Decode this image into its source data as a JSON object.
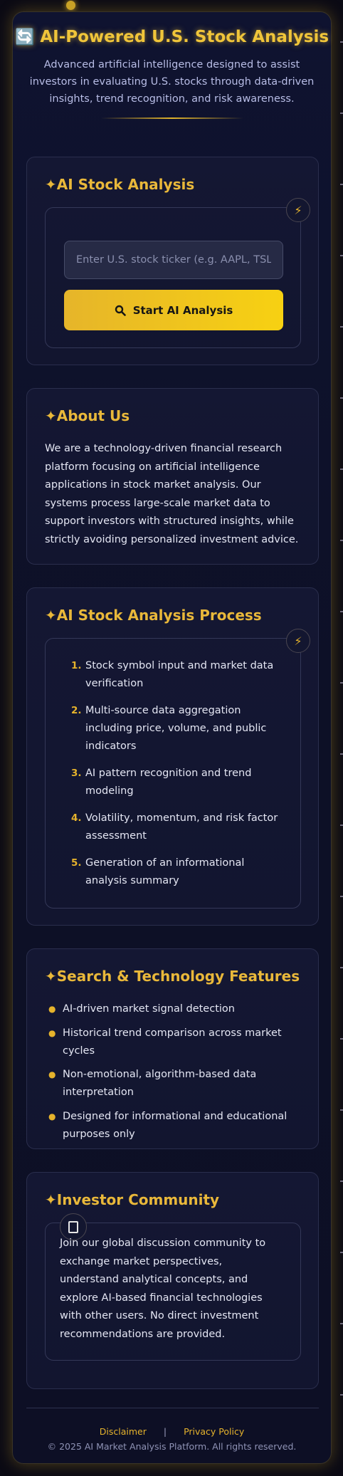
{
  "header": {
    "logo_icon": "🔄",
    "title": "AI-Powered U.S. Stock Analysis",
    "subtitle": "Advanced artificial intelligence designed to assist investors in evaluating U.S. stocks through data-driven insights, trend recognition, and risk awareness."
  },
  "analysis": {
    "title": "✦AI Stock Analysis",
    "badge_icon": "⚡",
    "input_placeholder": "Enter U.S. stock ticker (e.g. AAPL, TSLA, NVDA)",
    "button_label": "Start AI Analysis"
  },
  "about": {
    "title": "✦About Us",
    "text": "We are a technology-driven financial research platform focusing on artificial intelligence applications in stock market analysis. Our systems process large-scale market data to support investors with structured insights, while strictly avoiding personalized investment advice."
  },
  "process": {
    "title": "✦AI Stock Analysis Process",
    "badge_icon": "⚡",
    "steps": [
      {
        "num": "1.",
        "text": "Stock symbol input and market data verification"
      },
      {
        "num": "2.",
        "text": "Multi-source data aggregation including price, volume, and public indicators"
      },
      {
        "num": "3.",
        "text": "AI pattern recognition and trend modeling"
      },
      {
        "num": "4.",
        "text": "Volatility, momentum, and risk factor assessment"
      },
      {
        "num": "5.",
        "text": "Generation of an informational analysis summary"
      }
    ]
  },
  "features": {
    "title": "✦Search & Technology Features",
    "items": [
      "AI-driven market signal detection",
      "Historical trend comparison across market cycles",
      "Non-emotional, algorithm-based data interpretation",
      "Designed for informational and educational purposes only"
    ]
  },
  "community": {
    "title": "✦Investor Community",
    "text": "Join our global discussion community to exchange market perspectives, understand analytical concepts, and explore AI-based financial technologies with other users. No direct investment recommendations are provided."
  },
  "footer": {
    "disclaimer": "Disclaimer",
    "separator": "|",
    "privacy": "Privacy Policy",
    "copyright": "© 2025 AI Market Analysis Platform. All rights reserved."
  },
  "colors": {
    "accent_gold": "#e6b32c",
    "background": "#0d1026"
  }
}
